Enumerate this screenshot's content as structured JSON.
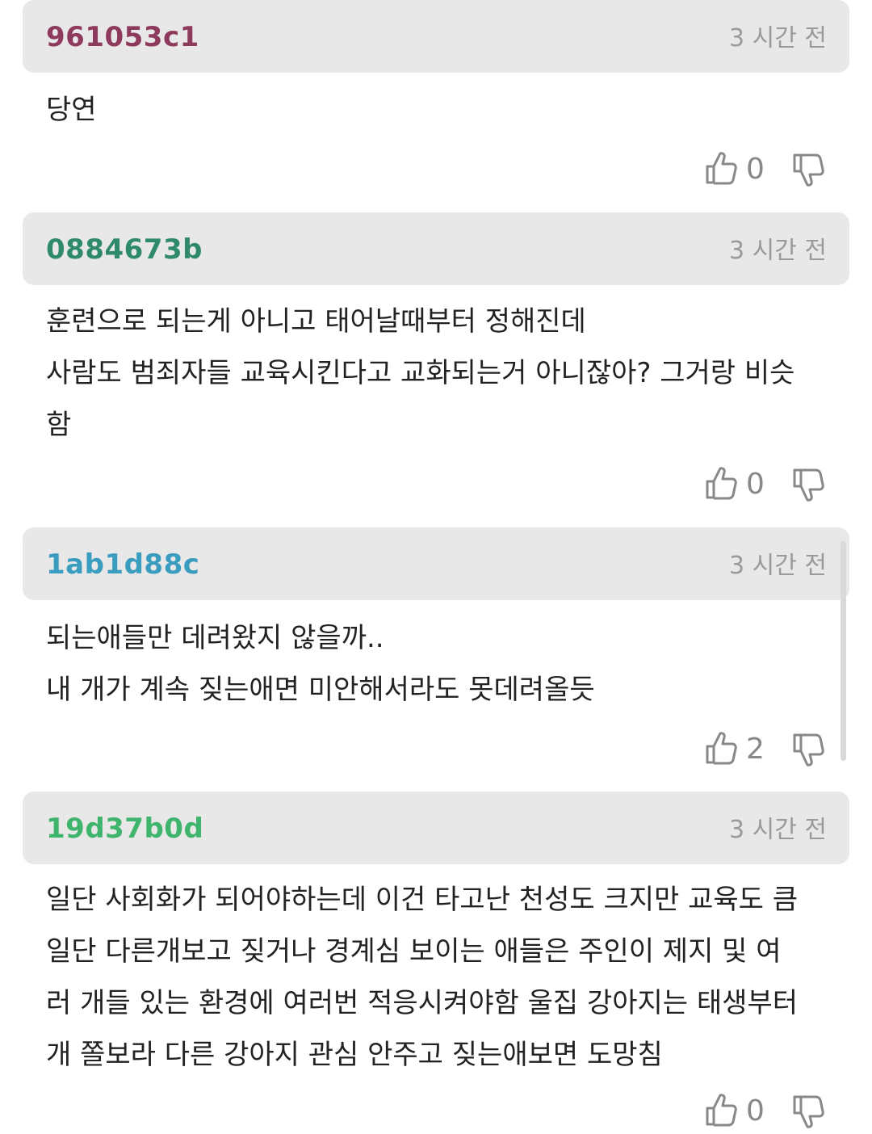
{
  "comments": [
    {
      "username": "961053c1",
      "username_color": "#8e3a5d",
      "timestamp": "3 시간 전",
      "lines": [
        "당연"
      ],
      "likes": "0"
    },
    {
      "username": "0884673b",
      "username_color": "#2f8a6c",
      "timestamp": "3 시간 전",
      "lines": [
        "훈련으로 되는게 아니고 태어날때부터 정해진데",
        "사람도 범죄자들 교육시킨다고 교화되는거 아니잖아? 그거랑 비슷",
        "함"
      ],
      "likes": "0"
    },
    {
      "username": "1ab1d88c",
      "username_color": "#3a9cbe",
      "timestamp": "3 시간 전",
      "lines": [
        "되는애들만 데려왔지 않을까..",
        "내 개가 계속 짖는애면 미안해서라도 못데려올듯"
      ],
      "likes": "2"
    },
    {
      "username": "19d37b0d",
      "username_color": "#3fb46c",
      "timestamp": "3 시간 전",
      "lines": [
        "일단 사회화가 되어야하는데 이건 타고난 천성도 크지만 교육도 큼",
        "일단 다른개보고 짖거나 경계심 보이는 애들은 주인이 제지 및 여",
        "러 개들 있는 환경에 여러번 적응시켜야함 울집 강아지는 태생부터",
        "개 쫄보라 다른 강아지 관심 안주고 짖는애보면 도망침"
      ],
      "likes": "0"
    }
  ],
  "icons": {
    "like": "thumbs-up-icon",
    "dislike": "thumbs-down-icon"
  },
  "colors": {
    "header_bg": "#e8e8e8",
    "timestamp": "#9a9a9a",
    "vote_count": "#888888"
  }
}
